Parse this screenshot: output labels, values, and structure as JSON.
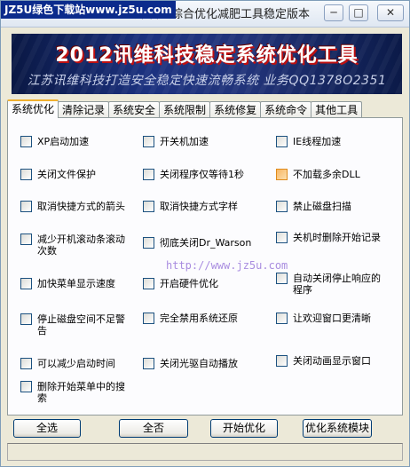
{
  "window": {
    "title_watermark": "JZ5U绿色下载站www.jz5u.com",
    "title": "讯维科技综合优化减肥工具稳定版本",
    "minimize": "─",
    "maximize": "□",
    "close": "✕"
  },
  "banner": {
    "title": "2012讯维科技稳定系统优化工具",
    "subtitle": "江苏讯维科技打造安全稳定快速流畅系统 业务QQ1378O2351"
  },
  "tabs": [
    {
      "label": "系统优化",
      "active": true
    },
    {
      "label": "清除记录",
      "active": false
    },
    {
      "label": "系统安全",
      "active": false
    },
    {
      "label": "系统限制",
      "active": false
    },
    {
      "label": "系统修复",
      "active": false
    },
    {
      "label": "系统命令",
      "active": false
    },
    {
      "label": "其他工具",
      "active": false
    }
  ],
  "options": [
    {
      "label": "XP启动加速",
      "checked": false
    },
    {
      "label": "开关机加速",
      "checked": false
    },
    {
      "label": "IE线程加速",
      "checked": false
    },
    {
      "label": "关闭文件保护",
      "checked": false
    },
    {
      "label": "关闭程序仅等待1秒",
      "checked": false
    },
    {
      "label": "不加载多余DLL",
      "checked": false
    },
    {
      "label": "取消快捷方式的箭头",
      "checked": false
    },
    {
      "label": "取消快捷方式字样",
      "checked": false
    },
    {
      "label": "禁止磁盘扫描",
      "checked": false
    },
    {
      "label": "减少开机滚动条滚动次数",
      "checked": false
    },
    {
      "label": "彻底关闭Dr_Warson",
      "checked": false
    },
    {
      "label": "关机时删除开始记录",
      "checked": false
    },
    {
      "label": "加快菜单显示速度",
      "checked": false
    },
    {
      "label": "开启硬件优化",
      "checked": false
    },
    {
      "label": "自动关闭停止响应的程序",
      "checked": false
    },
    {
      "label": "停止磁盘空间不足警告",
      "checked": false
    },
    {
      "label": "完全禁用系统还原",
      "checked": false
    },
    {
      "label": "让欢迎窗口更清晰",
      "checked": false
    },
    {
      "label": "可以减少启动时间",
      "checked": false
    },
    {
      "label": "关闭光驱自动播放",
      "checked": false
    },
    {
      "label": "关闭动画显示窗口",
      "checked": false
    },
    {
      "label": "删除开始菜单中的搜索",
      "checked": false
    }
  ],
  "watermark_url": "http://www.jz5u.com",
  "buttons": {
    "select_all": "全选",
    "select_none": "全否",
    "start_optimize": "开始优化",
    "optimize_module": "优化系统模块"
  },
  "colors": {
    "tab_active_accent": "#f0b030",
    "banner_bg": "#1c3280",
    "watermark_bg": "#0b2b8c"
  }
}
